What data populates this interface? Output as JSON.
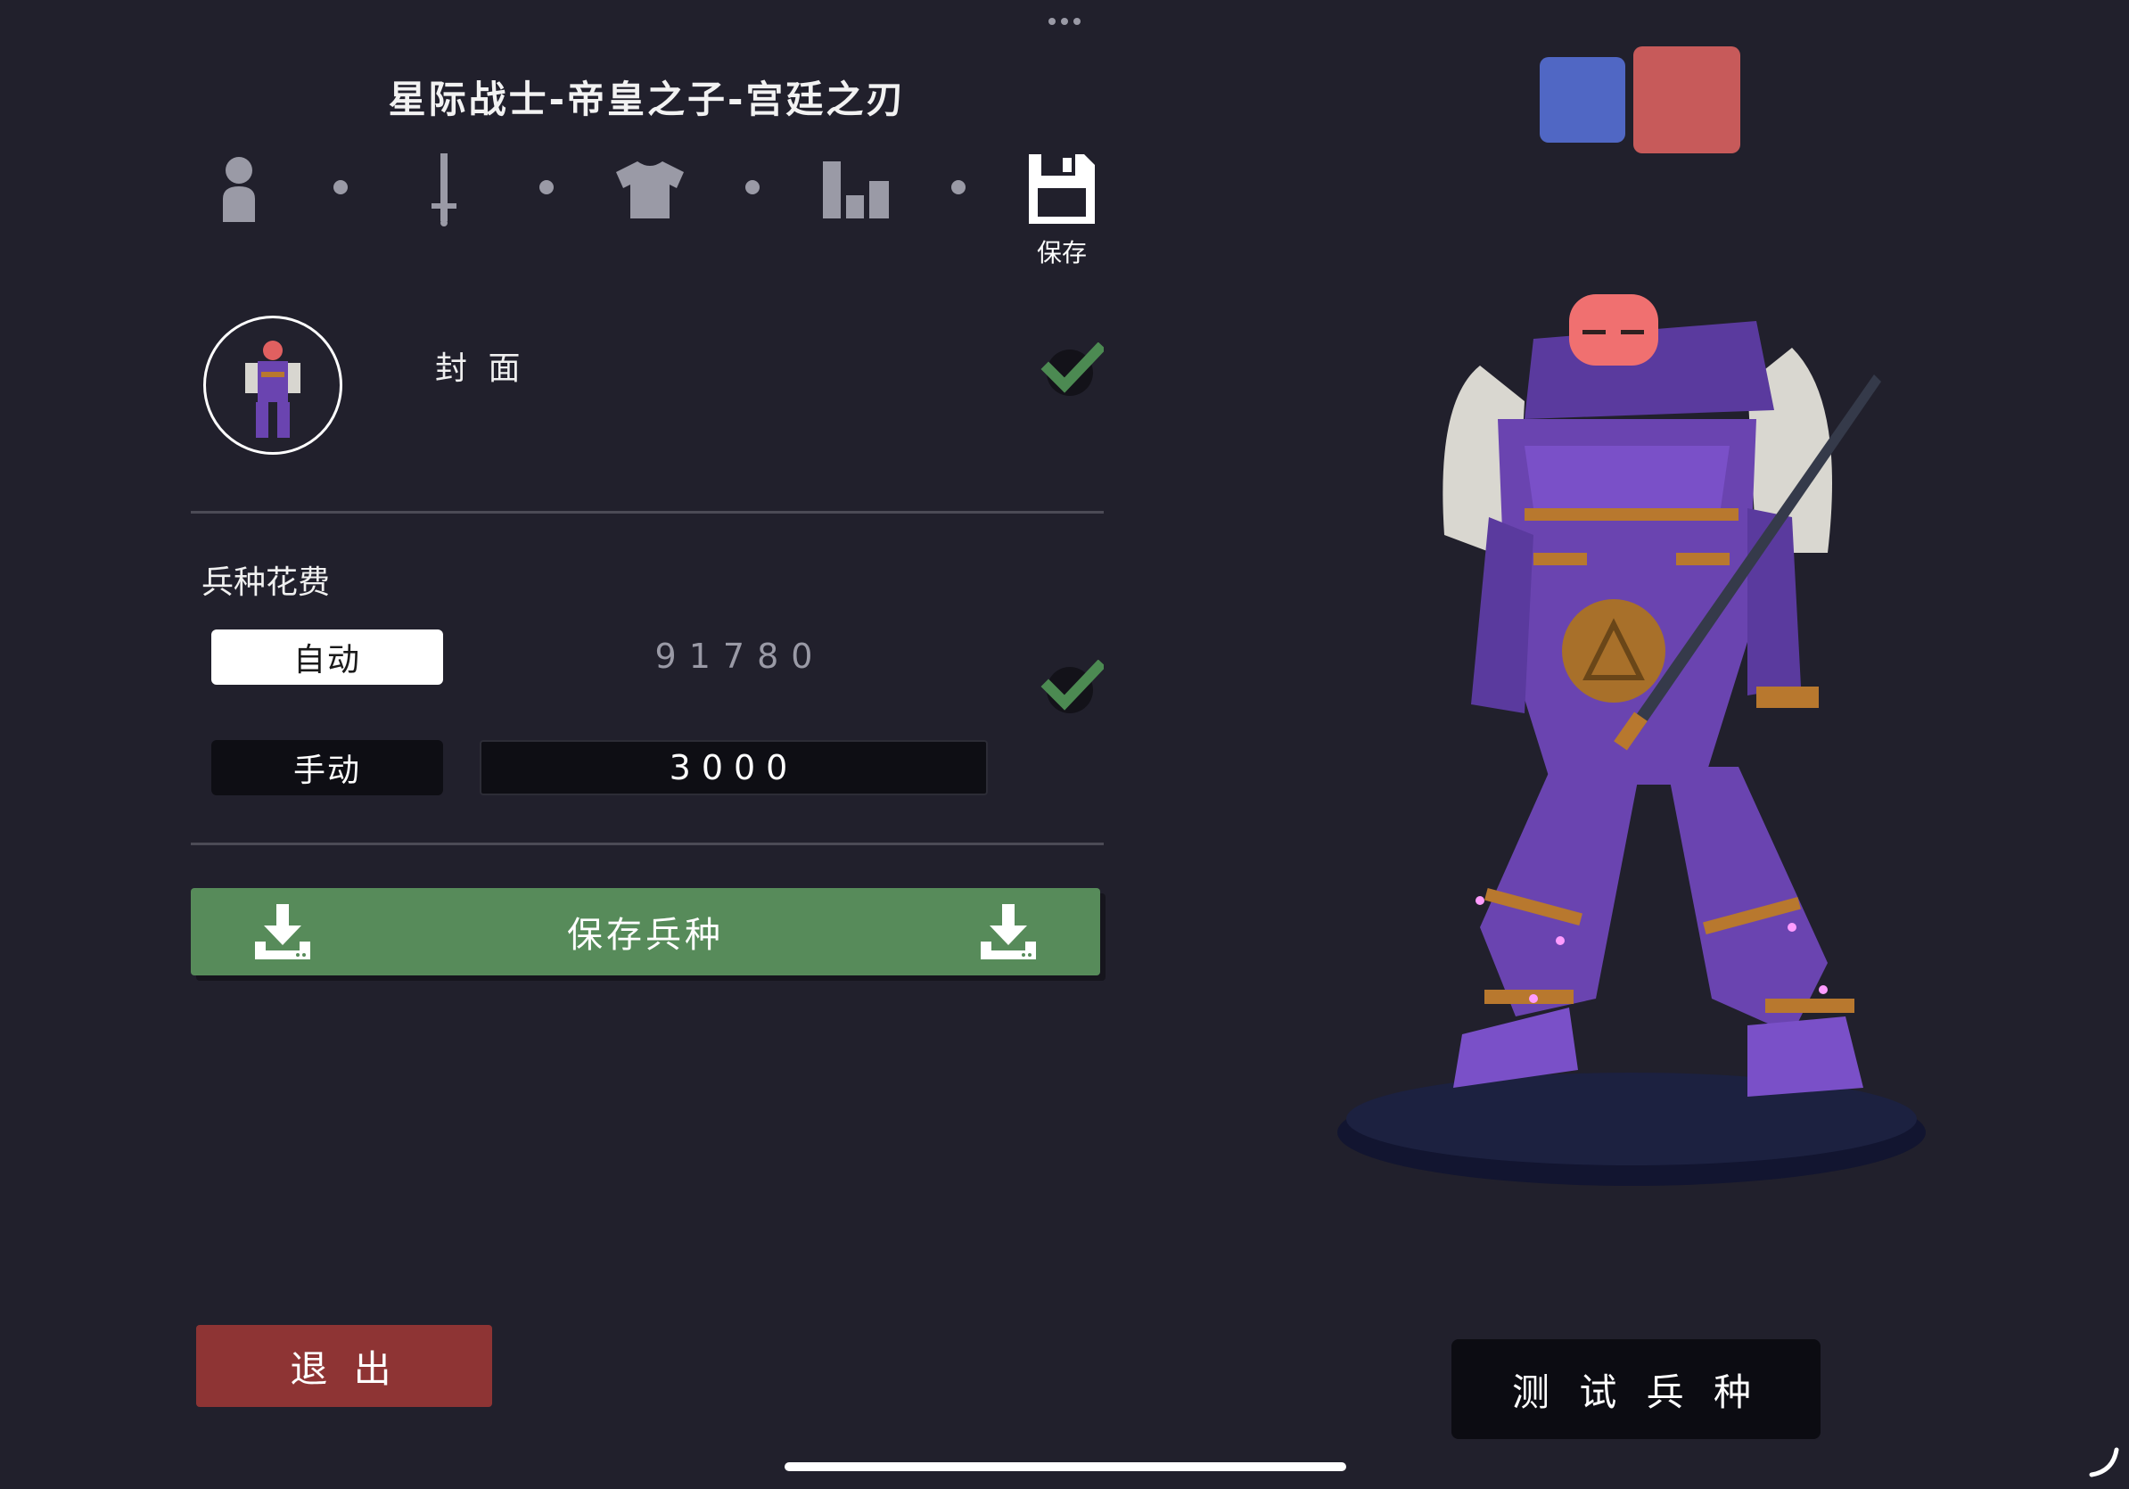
{
  "header": {
    "title": "星际战士-帝皇之子-宫廷之刃",
    "save_label": "保存"
  },
  "steps": [
    {
      "name": "person-icon"
    },
    {
      "name": "sword-icon"
    },
    {
      "name": "shirt-icon"
    },
    {
      "name": "bar-chart-icon"
    },
    {
      "name": "floppy-disk-icon"
    }
  ],
  "cover": {
    "label": "封 面"
  },
  "cost": {
    "title": "兵种花费",
    "auto_label": "自动",
    "auto_value": "91780",
    "manual_label": "手动",
    "manual_value": "3000"
  },
  "actions": {
    "save_unit": "保存兵种",
    "exit": "退 出",
    "test_unit": "测 试 兵 种"
  },
  "teams": {
    "blue_color": "#5067c4",
    "red_color": "#c75a5a"
  },
  "colors": {
    "background": "#21202c",
    "save_green": "#578b5a",
    "exit_red": "#8e3434",
    "armor_purple": "#6a44b0",
    "trim_orange": "#b8782e"
  }
}
